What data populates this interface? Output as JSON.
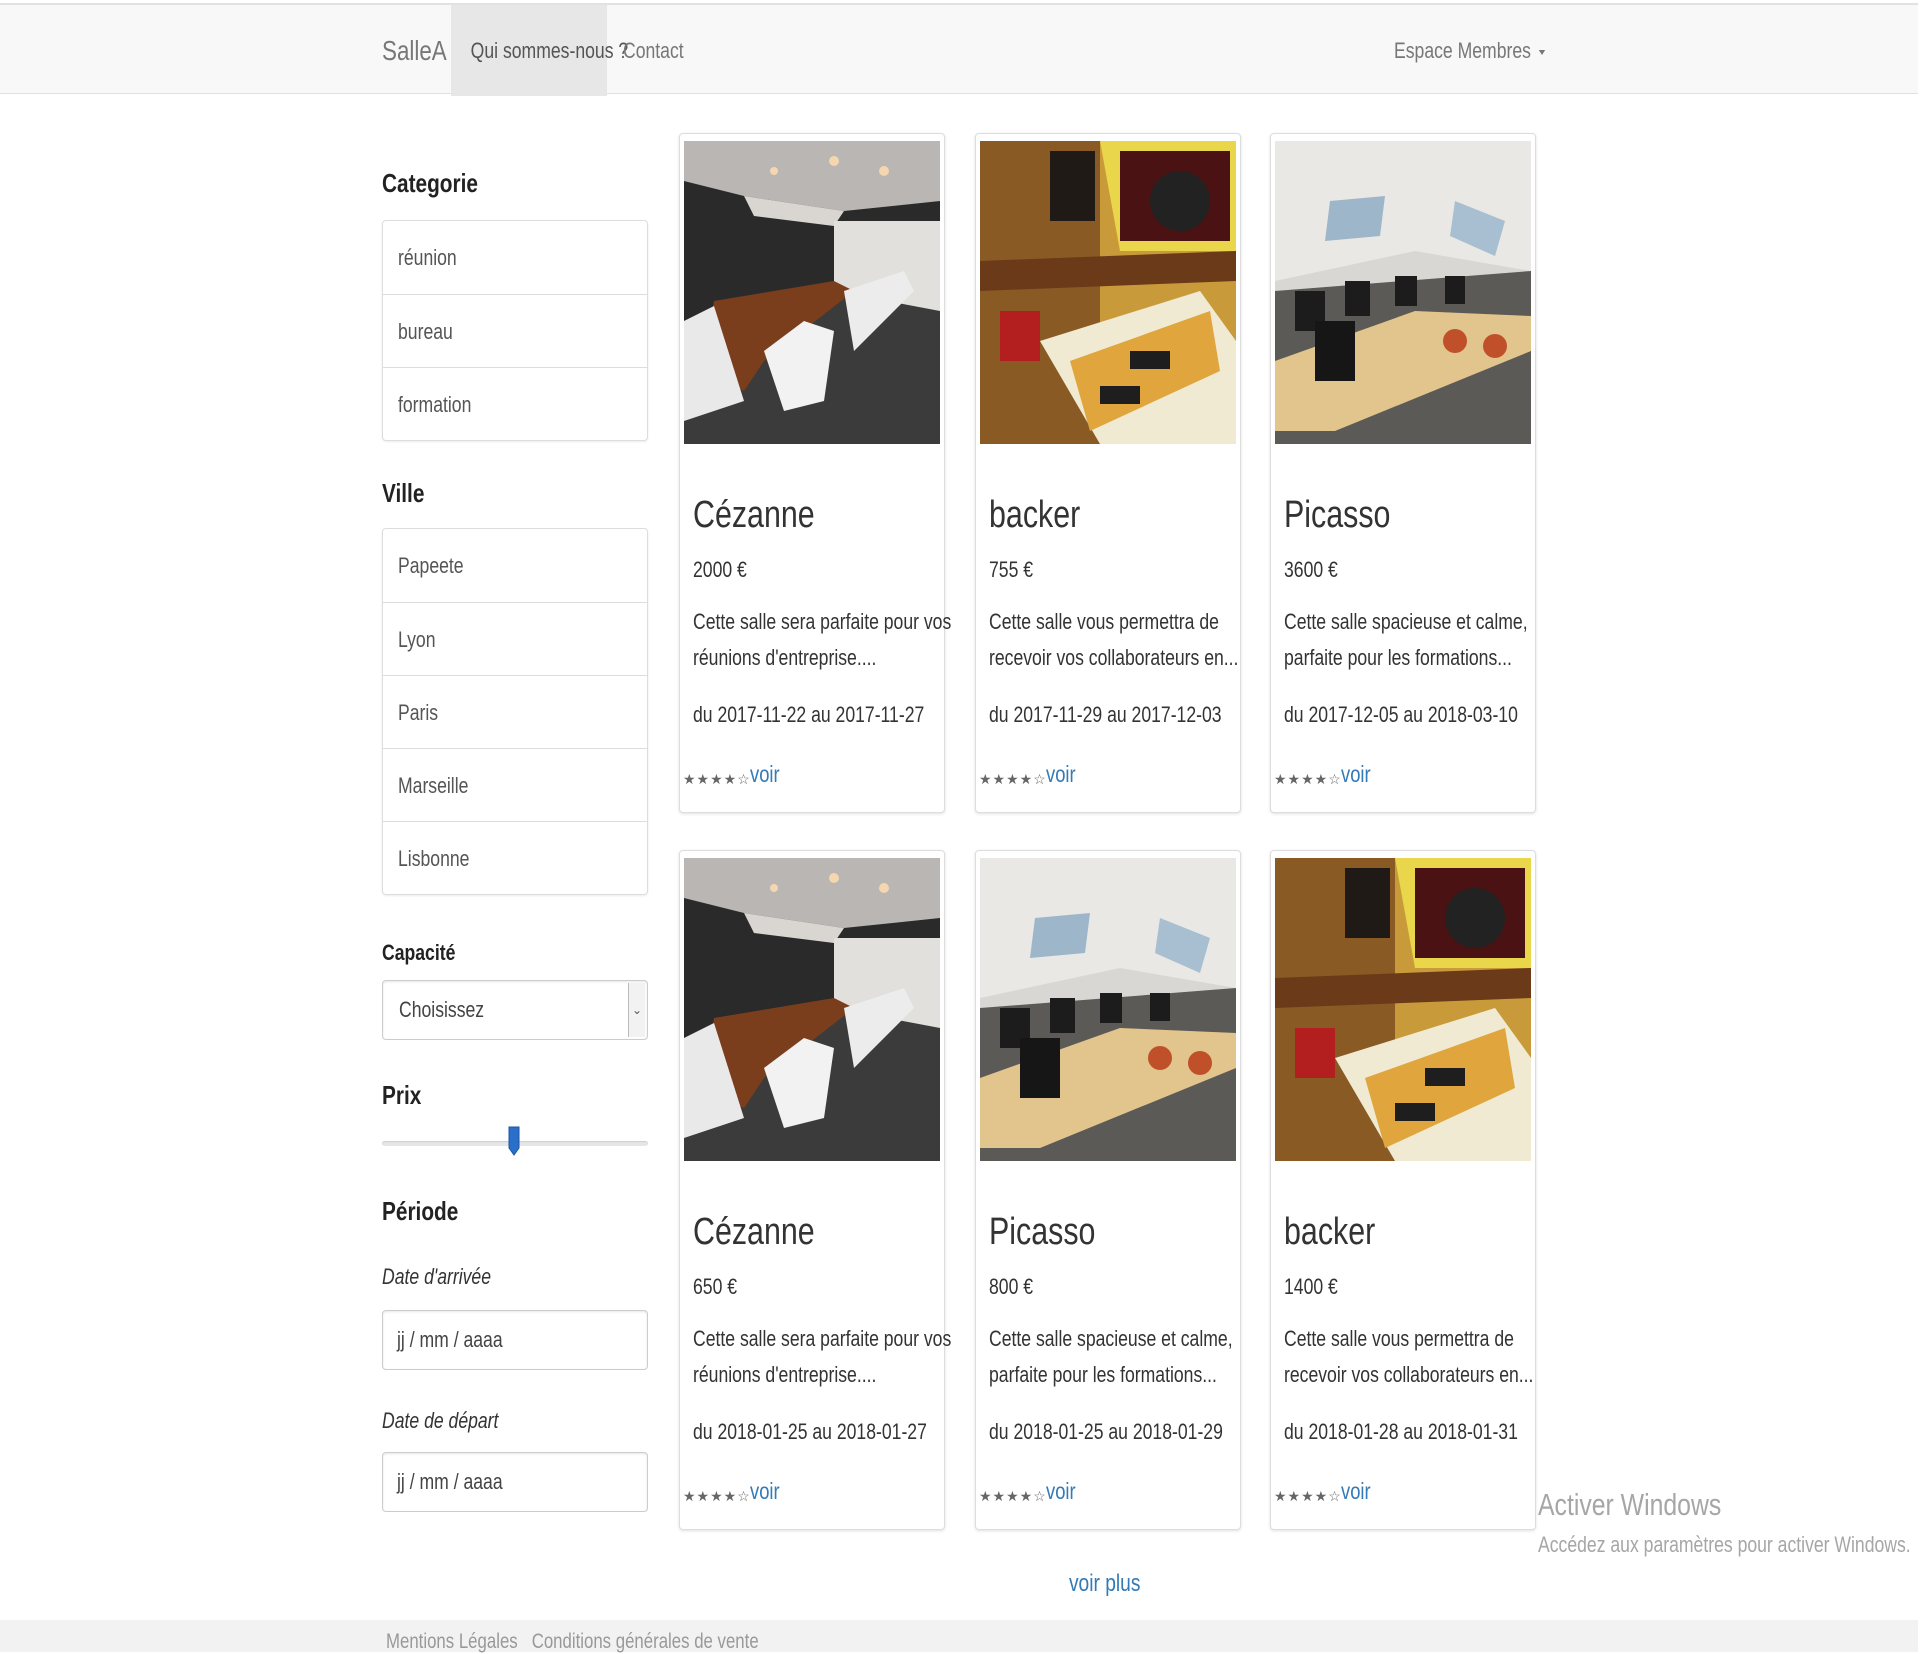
{
  "navbar": {
    "brand": "SalleA",
    "items": [
      {
        "label": "Qui sommes-nous ?",
        "active": true
      },
      {
        "label": "Contact",
        "active": false
      }
    ],
    "member_menu": "Espace Membres"
  },
  "sidebar": {
    "category_heading": "Categorie",
    "categories": [
      "réunion",
      "bureau",
      "formation"
    ],
    "city_heading": "Ville",
    "cities": [
      "Papeete",
      "Lyon",
      "Paris",
      "Marseille",
      "Lisbonne"
    ],
    "capacity_heading": "Capacité",
    "capacity_select": "Choisissez",
    "price_heading": "Prix",
    "price_slider_level": 0.5,
    "period_heading": "Période",
    "arrival_label": "Date d'arrivée",
    "arrival_placeholder": "jj / mm / aaaa",
    "departure_label": "Date de départ",
    "departure_placeholder": "jj / mm / aaaa"
  },
  "rating_stars": "★★★★☆",
  "voir_label": "voir",
  "products": [
    {
      "title": "Cézanne",
      "price": "2000 €",
      "desc_line1": "Cette salle sera parfaite pour vos",
      "desc_line2": "réunions d'entreprise....",
      "dates": "du 2017-11-22 au 2017-11-27",
      "image": "conference-room-photo"
    },
    {
      "title": "backer",
      "price": "755 €",
      "desc_line1": "Cette salle vous permettra de",
      "desc_line2": "recevoir vos collaborateurs en...",
      "dates": "du 2017-11-29 au 2017-12-03",
      "image": "pub-room-photo"
    },
    {
      "title": "Picasso",
      "price": "3600 €",
      "desc_line1": "Cette salle spacieuse et calme,",
      "desc_line2": "parfaite pour les formations...",
      "dates": "du 2017-12-05 au 2018-03-10",
      "image": "computer-room-photo"
    },
    {
      "title": "Cézanne",
      "price": "650 €",
      "desc_line1": "Cette salle sera parfaite pour vos",
      "desc_line2": "réunions d'entreprise....",
      "dates": "du 2018-01-25 au 2018-01-27",
      "image": "conference-room-photo"
    },
    {
      "title": "Picasso",
      "price": "800 €",
      "desc_line1": "Cette salle spacieuse et calme,",
      "desc_line2": "parfaite pour les formations...",
      "dates": "du 2018-01-25 au 2018-01-29",
      "image": "computer-room-photo"
    },
    {
      "title": "backer",
      "price": "1400 €",
      "desc_line1": "Cette salle vous permettra de",
      "desc_line2": "recevoir vos collaborateurs en...",
      "dates": "du 2018-01-28 au 2018-01-31",
      "image": "pub-room-photo"
    }
  ],
  "voir_plus": "voir plus",
  "watermark": {
    "title": "Activer Windows",
    "subtitle": "Accédez aux paramètres pour activer Windows."
  },
  "footer": {
    "links": [
      "Mentions Légales",
      "Conditions générales de vente"
    ]
  },
  "colors": {
    "link": "#337ab7",
    "navbar_bg": "#f8f8f8",
    "slider_thumb": "#2a6fc9"
  }
}
